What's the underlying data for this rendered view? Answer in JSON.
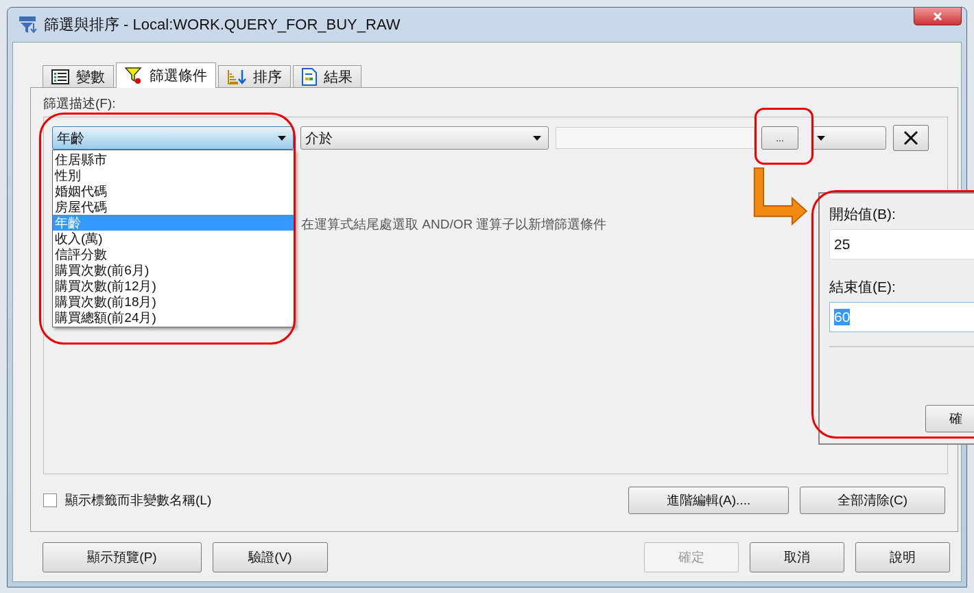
{
  "window": {
    "title": "篩選與排序 - Local:WORK.QUERY_FOR_BUY_RAW"
  },
  "tabs": [
    {
      "label": "變數",
      "selected": false
    },
    {
      "label": "篩選條件",
      "selected": true
    },
    {
      "label": "排序",
      "selected": false
    },
    {
      "label": "結果",
      "selected": false
    }
  ],
  "filter_label": "篩選描述(F):",
  "condition": {
    "variable": "年齡",
    "operator": "介於",
    "browse_button": "..."
  },
  "variable_list": [
    {
      "label": "住居縣市",
      "selected": false
    },
    {
      "label": "性別",
      "selected": false
    },
    {
      "label": "婚姻代碼",
      "selected": false
    },
    {
      "label": "房屋代碼",
      "selected": false
    },
    {
      "label": "年齡",
      "selected": true
    },
    {
      "label": "收入(萬)",
      "selected": false
    },
    {
      "label": "信評分數",
      "selected": false
    },
    {
      "label": "購買次數(前6月)",
      "selected": false
    },
    {
      "label": "購買次數(前12月)",
      "selected": false
    },
    {
      "label": "購買次數(前18月)",
      "selected": false
    },
    {
      "label": "購買總額(前24月)",
      "selected": false
    }
  ],
  "hint": "在運算式結尾處選取 AND/OR 運算子以新增篩選條件",
  "range_popup": {
    "start_label": "開始值(B):",
    "start_value": "25",
    "end_label": "結束值(E):",
    "end_value": "60",
    "end_value_selected": true,
    "ok_button": "確"
  },
  "show_labels_checkbox": {
    "label": "顯示標籤而非變數名稱(L)",
    "checked": false
  },
  "panel_buttons": [
    {
      "label": "進階編輯(A)...."
    },
    {
      "label": "全部清除(C)"
    }
  ],
  "footer_buttons": [
    {
      "label": "顯示預覽(P)",
      "disabled": false
    },
    {
      "label": "驗證(V)",
      "disabled": false
    },
    {
      "label": "確定",
      "disabled": true
    },
    {
      "label": "取消",
      "disabled": false
    },
    {
      "label": "說明",
      "disabled": false
    }
  ]
}
